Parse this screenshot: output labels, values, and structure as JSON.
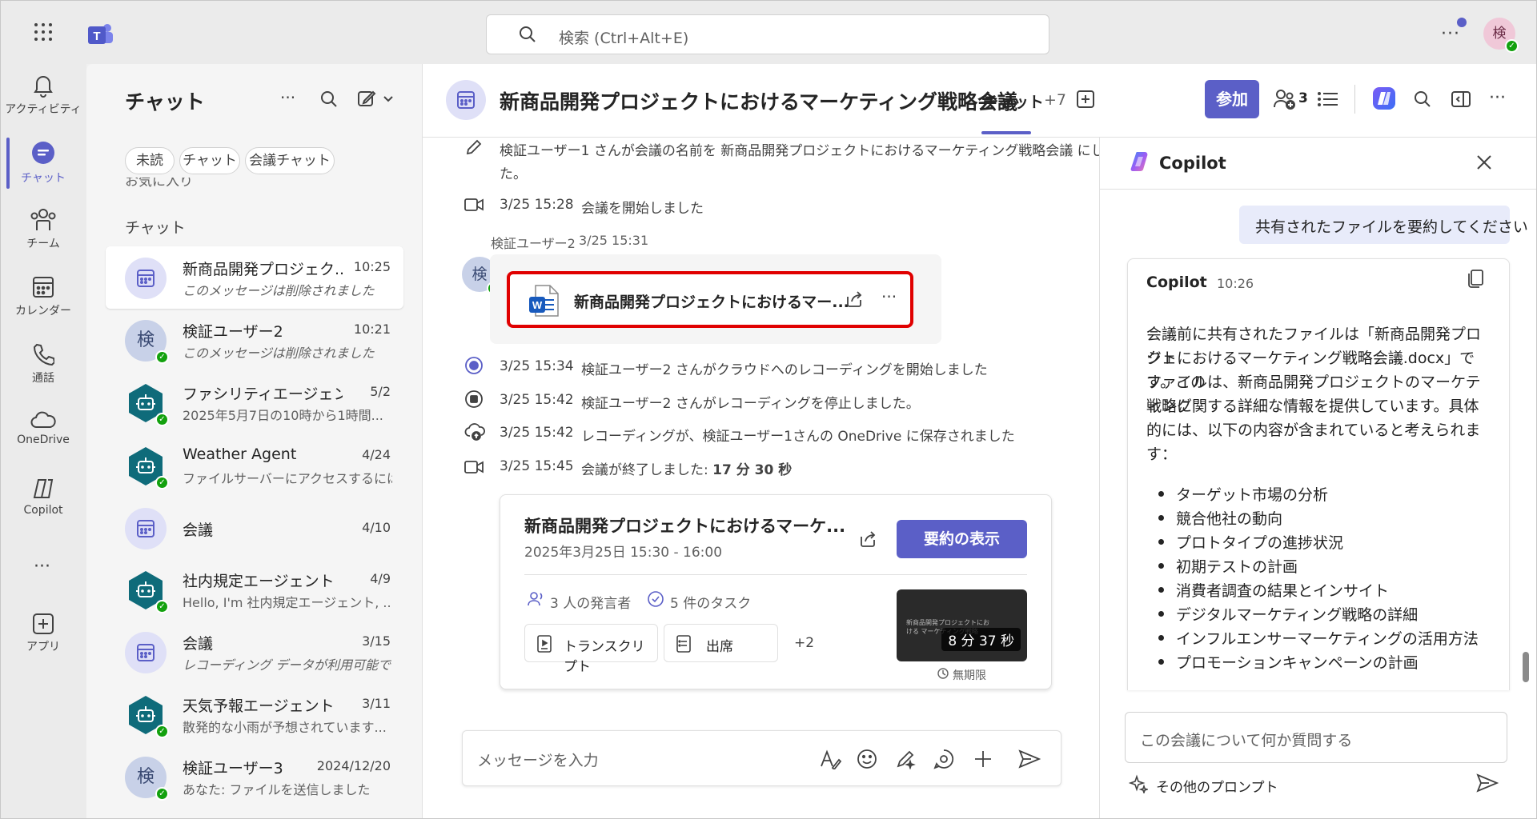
{
  "topbar": {
    "search_placeholder": "検索 (Ctrl+Alt+E)",
    "avatar_initial": "検"
  },
  "rail": [
    {
      "label": "アクティビティ",
      "icon": "bell-icon"
    },
    {
      "label": "チャット",
      "icon": "chat-icon",
      "active": true
    },
    {
      "label": "チーム",
      "icon": "teams-icon"
    },
    {
      "label": "カレンダー",
      "icon": "calendar-icon"
    },
    {
      "label": "通話",
      "icon": "phone-icon"
    },
    {
      "label": "OneDrive",
      "icon": "cloud-icon"
    },
    {
      "label": "Copilot",
      "icon": "copilot-icon"
    },
    {
      "label": "アプリ",
      "icon": "apps-icon"
    }
  ],
  "chat_list": {
    "title": "チャット",
    "filters": [
      "未読",
      "チャット",
      "会議チャット"
    ],
    "partial_section": "お気に入り",
    "section_label": "チャット",
    "items": [
      {
        "name": "新商品開発プロジェク...",
        "time": "10:25",
        "preview": "このメッセージは削除されました",
        "avatar": "calendar",
        "italic": true
      },
      {
        "name": "検証ユーザー2",
        "time": "10:21",
        "preview": "このメッセージは削除されました",
        "avatar": "user",
        "initial": "検",
        "italic": true
      },
      {
        "name": "ファシリティエージェント",
        "time": "5/2",
        "preview": "2025年5月7日の10時から1時間...",
        "avatar": "bot"
      },
      {
        "name": "Weather Agent",
        "time": "4/24",
        "preview": "ファイルサーバーにアクセスするには、...",
        "avatar": "bot"
      },
      {
        "name": "会議",
        "time": "4/10",
        "preview": "",
        "avatar": "calendar"
      },
      {
        "name": "社内規定エージェント",
        "time": "4/9",
        "preview": "Hello, I'm 社内規定エージェント, ...",
        "avatar": "bot"
      },
      {
        "name": "会議",
        "time": "3/15",
        "preview": "レコーディング データが利用可能です",
        "avatar": "calendar",
        "italic": true
      },
      {
        "name": "天気予報エージェント",
        "time": "3/11",
        "preview": "散発的な小雨が予想されています...",
        "avatar": "bot"
      },
      {
        "name": "検証ユーザー3",
        "time": "2024/12/20",
        "preview": "あなた: ファイルを送信しました",
        "avatar": "user",
        "initial": "検"
      }
    ]
  },
  "header": {
    "title": "新商品開発プロジェクトにおけるマーケティング戦略会議",
    "tab_chat": "チャット",
    "more_tabs": "+7",
    "join_button": "参加",
    "participants_count": "3"
  },
  "messages": {
    "rename_line1": "検証ユーザー1 さんが会議の名前を 新商品開発プロジェクトにおけるマーケティング戦略会議 にしまし",
    "rename_line2": "た。",
    "started": {
      "time": "3/25 15:28",
      "text": "会議を開始しました"
    },
    "sender": "検証ユーザー2",
    "sender_time": "3/25 15:31",
    "sender_initial": "検",
    "file_name": "新商品開発プロジェクトにおけるマー...",
    "rec_start": {
      "time": "3/25 15:34",
      "text": "検証ユーザー2 さんがクラウドへのレコーディングを開始しました"
    },
    "rec_stop": {
      "time": "3/25 15:42",
      "text": "検証ユーザー2 さんがレコーディングを停止しました。"
    },
    "rec_saved": {
      "time": "3/25 15:42",
      "text": "レコーディングが、検証ユーザー1さんの OneDrive に保存されました"
    },
    "ended": {
      "time": "3/25 15:45",
      "text": "会議が終了しました: ",
      "duration": "17 分 30 秒"
    }
  },
  "recap_card": {
    "title": "新商品開発プロジェクトにおけるマーケ...",
    "datetime": "2025年3月25日 15:30 - 16:00",
    "summary_button": "要約の表示",
    "speakers": "3 人の発言者",
    "tasks": "5 件のタスク",
    "transcript": "トランスクリプト",
    "attendance": "出席",
    "more": "+2",
    "thumb_title": "新商品開発プロジェクトにおける マーケティング戦略",
    "duration": "8 分 37 秒",
    "retention": "無期限"
  },
  "composer": {
    "placeholder": "メッセージを入力"
  },
  "copilot": {
    "title": "Copilot",
    "user_prompt": "共有されたファイルを要約してください",
    "response_name": "Copilot",
    "response_time": "10:26",
    "response_lines": [
      "会議前に共有されたファイルは「新商品開発プロジェ",
      "クトにおけるマーケティング戦略会議.docx」です。この",
      "ファイルは、新商品開発プロジェクトのマーケティング",
      "戦略に関する詳細な情報を提供しています。具体",
      "的には、以下の内容が含まれていると考えられま",
      "す："
    ],
    "bullets": [
      "ターゲット市場の分析",
      "競合他社の動向",
      "プロトタイプの進捗状況",
      "初期テストの計画",
      "消費者調査の結果とインサイト",
      "デジタルマーケティング戦略の詳細",
      "インフルエンサーマーケティングの活用方法",
      "プロモーションキャンペーンの計画"
    ],
    "input_placeholder": "この会議について何か質問する",
    "more_prompts": "その他のプロンプト"
  },
  "colors": {
    "brand": "#5b5fc7",
    "highlight": "#e00000",
    "presence": "#13a10e",
    "bot": "#0f6b7a"
  }
}
